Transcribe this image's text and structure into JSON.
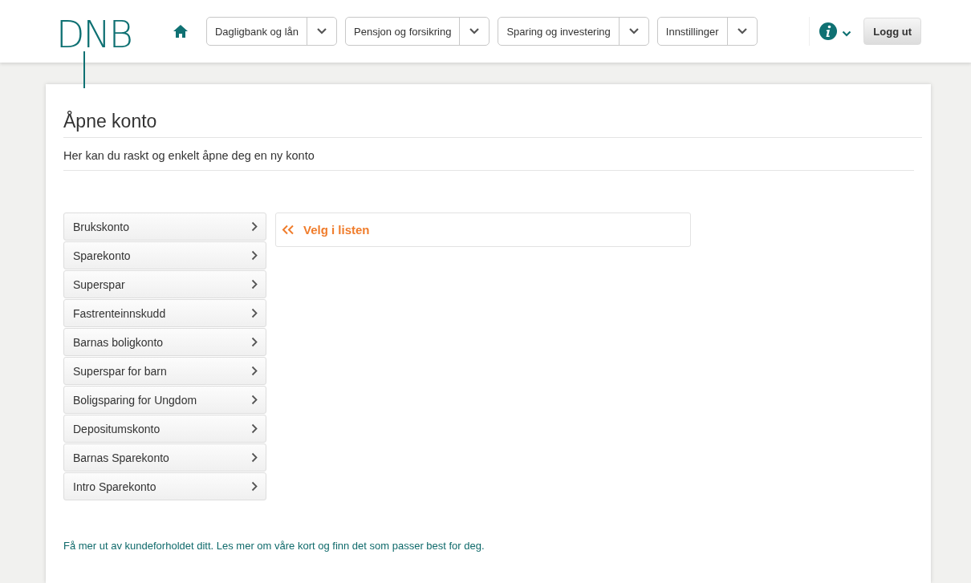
{
  "header": {
    "logo": "DNB",
    "nav": [
      {
        "label": "Dagligbank og lån"
      },
      {
        "label": "Pensjon og forsikring"
      },
      {
        "label": "Sparing og investering"
      },
      {
        "label": "Innstillinger"
      }
    ],
    "logout": "Logg ut"
  },
  "page": {
    "title": "Åpne konto",
    "subtitle": "Her kan du raskt og enkelt åpne deg en ny konto"
  },
  "accounts": [
    {
      "label": "Brukskonto"
    },
    {
      "label": "Sparekonto"
    },
    {
      "label": "Superspar"
    },
    {
      "label": "Fastrenteinnskudd"
    },
    {
      "label": "Barnas boligkonto"
    },
    {
      "label": "Superspar for barn"
    },
    {
      "label": "Boligsparing for Ungdom"
    },
    {
      "label": "Depositumskonto"
    },
    {
      "label": "Barnas Sparekonto"
    },
    {
      "label": "Intro Sparekonto"
    }
  ],
  "hint": "Velg i listen",
  "footer_link": "Få mer ut av kundeforholdet ditt. Les mer om våre kort og finn det som passer best for deg."
}
